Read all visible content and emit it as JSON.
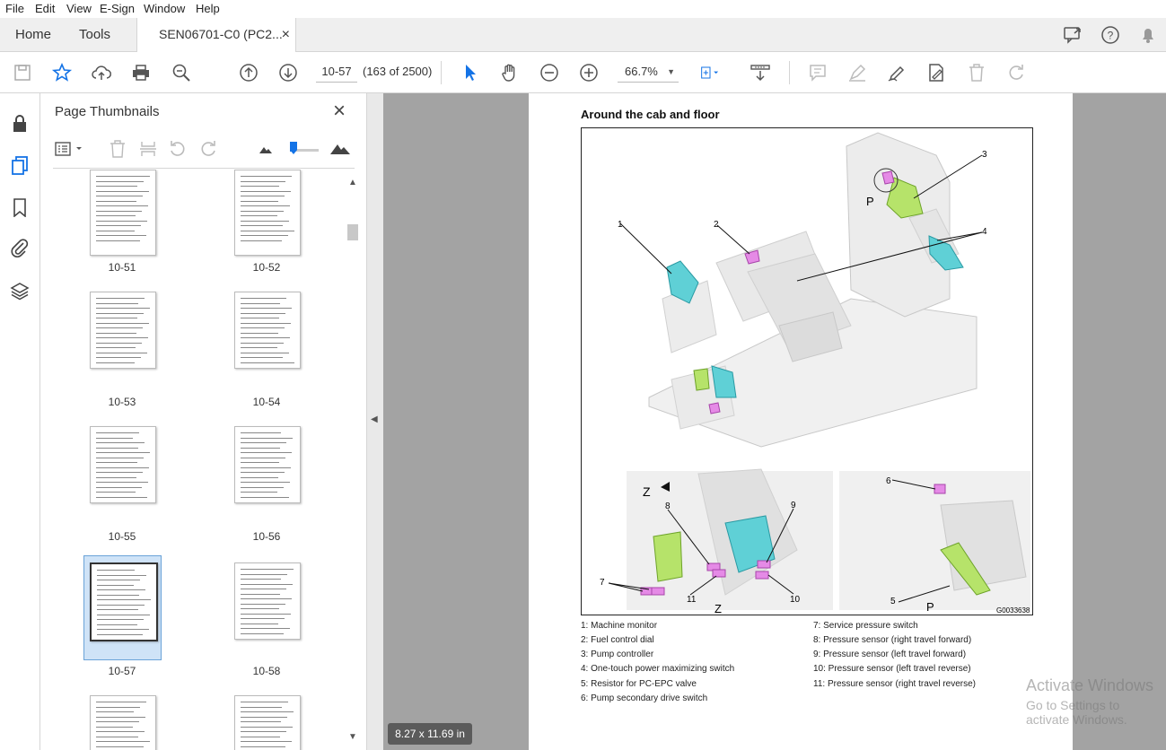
{
  "menu": [
    "File",
    "Edit",
    "View",
    "E-Sign",
    "Window",
    "Help"
  ],
  "tabs": {
    "home": "Home",
    "tools": "Tools",
    "document": "SEN06701-C0 (PC2...",
    "close": "×"
  },
  "toolbar": {
    "page_input": "10-57",
    "page_count": "(163 of 2500)",
    "zoom": "66.7%"
  },
  "panel": {
    "title": "Page Thumbnails",
    "close": "×",
    "thumbnails": [
      {
        "label": "10-51"
      },
      {
        "label": "10-52"
      },
      {
        "label": "10-53"
      },
      {
        "label": "10-54"
      },
      {
        "label": "10-55"
      },
      {
        "label": "10-56"
      },
      {
        "label": "10-57",
        "selected": true
      },
      {
        "label": "10-58"
      }
    ]
  },
  "document": {
    "heading": "Around the cab and floor",
    "figure_id": "G0033638",
    "view_labels": {
      "p_top": "P",
      "z_main": "Z",
      "z_bottom": "Z",
      "p_bottom": "P"
    },
    "callouts": [
      "1",
      "2",
      "3",
      "4",
      "5",
      "6",
      "7",
      "8",
      "9",
      "10",
      "11"
    ],
    "legend_left": [
      "1: Machine monitor",
      "2: Fuel control dial",
      "3: Pump controller",
      "4: One-touch power maximizing switch",
      "5: Resistor for PC-EPC valve",
      "6: Pump secondary drive switch"
    ],
    "legend_right": [
      "7: Service pressure switch",
      "8: Pressure sensor (right travel forward)",
      "9: Pressure sensor (left travel forward)",
      "10: Pressure sensor (left travel reverse)",
      "11: Pressure sensor (right travel reverse)"
    ]
  },
  "status": {
    "page_size": "8.27 x 11.69 in"
  },
  "watermark": {
    "line1": "Activate Windows",
    "line2": "Go to Settings to activate Windows."
  },
  "colors": {
    "accent": "#1473e6",
    "cyan_part": "#5fd0d6",
    "green_part": "#b6e36a",
    "magenta_part": "#e58ae6"
  }
}
